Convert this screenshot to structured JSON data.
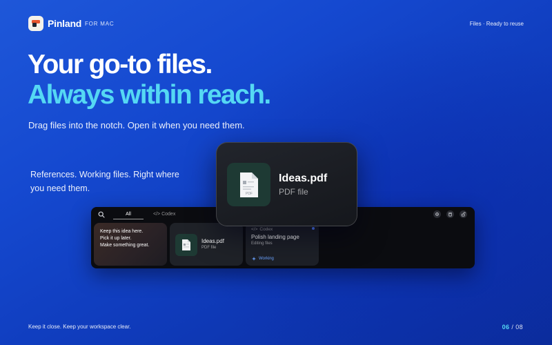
{
  "header": {
    "brand": "Pinland",
    "platform": "FOR MAC",
    "status": "Files · Ready to reuse"
  },
  "hero": {
    "headline_1": "Your go-to files.",
    "headline_2": "Always within reach.",
    "lead": "Drag files into the notch. Open it when you need them.",
    "note_line_1": "References. Working files. Right where",
    "note_line_2": "you need them."
  },
  "notch": {
    "tabs": [
      {
        "label": "All",
        "active": true
      },
      {
        "label": "Codex",
        "active": false
      }
    ],
    "icons": [
      "settings-icon",
      "trash-icon",
      "unlock-icon"
    ],
    "note_card": {
      "lines": [
        "Keep this idea here.",
        "Pick it up later.",
        "Make something great."
      ]
    },
    "file_card": {
      "name": "Ideas.pdf",
      "kind": "PDF file"
    },
    "codex_card": {
      "label": "Codex",
      "title": "Polish landing page",
      "subtitle": "Editing files",
      "status": "Working"
    }
  },
  "popup": {
    "name": "Ideas.pdf",
    "kind": "PDF file",
    "badge": "PDF"
  },
  "footer": {
    "tagline": "Keep it close. Keep your workspace clear.",
    "page_current": "06",
    "page_sep": "/",
    "page_total": "08"
  },
  "colors": {
    "accent_cyan": "#55d8f3",
    "background": "#1549d0",
    "file_thumb": "#1e3a34",
    "working_blue": "#6aa2ff"
  }
}
